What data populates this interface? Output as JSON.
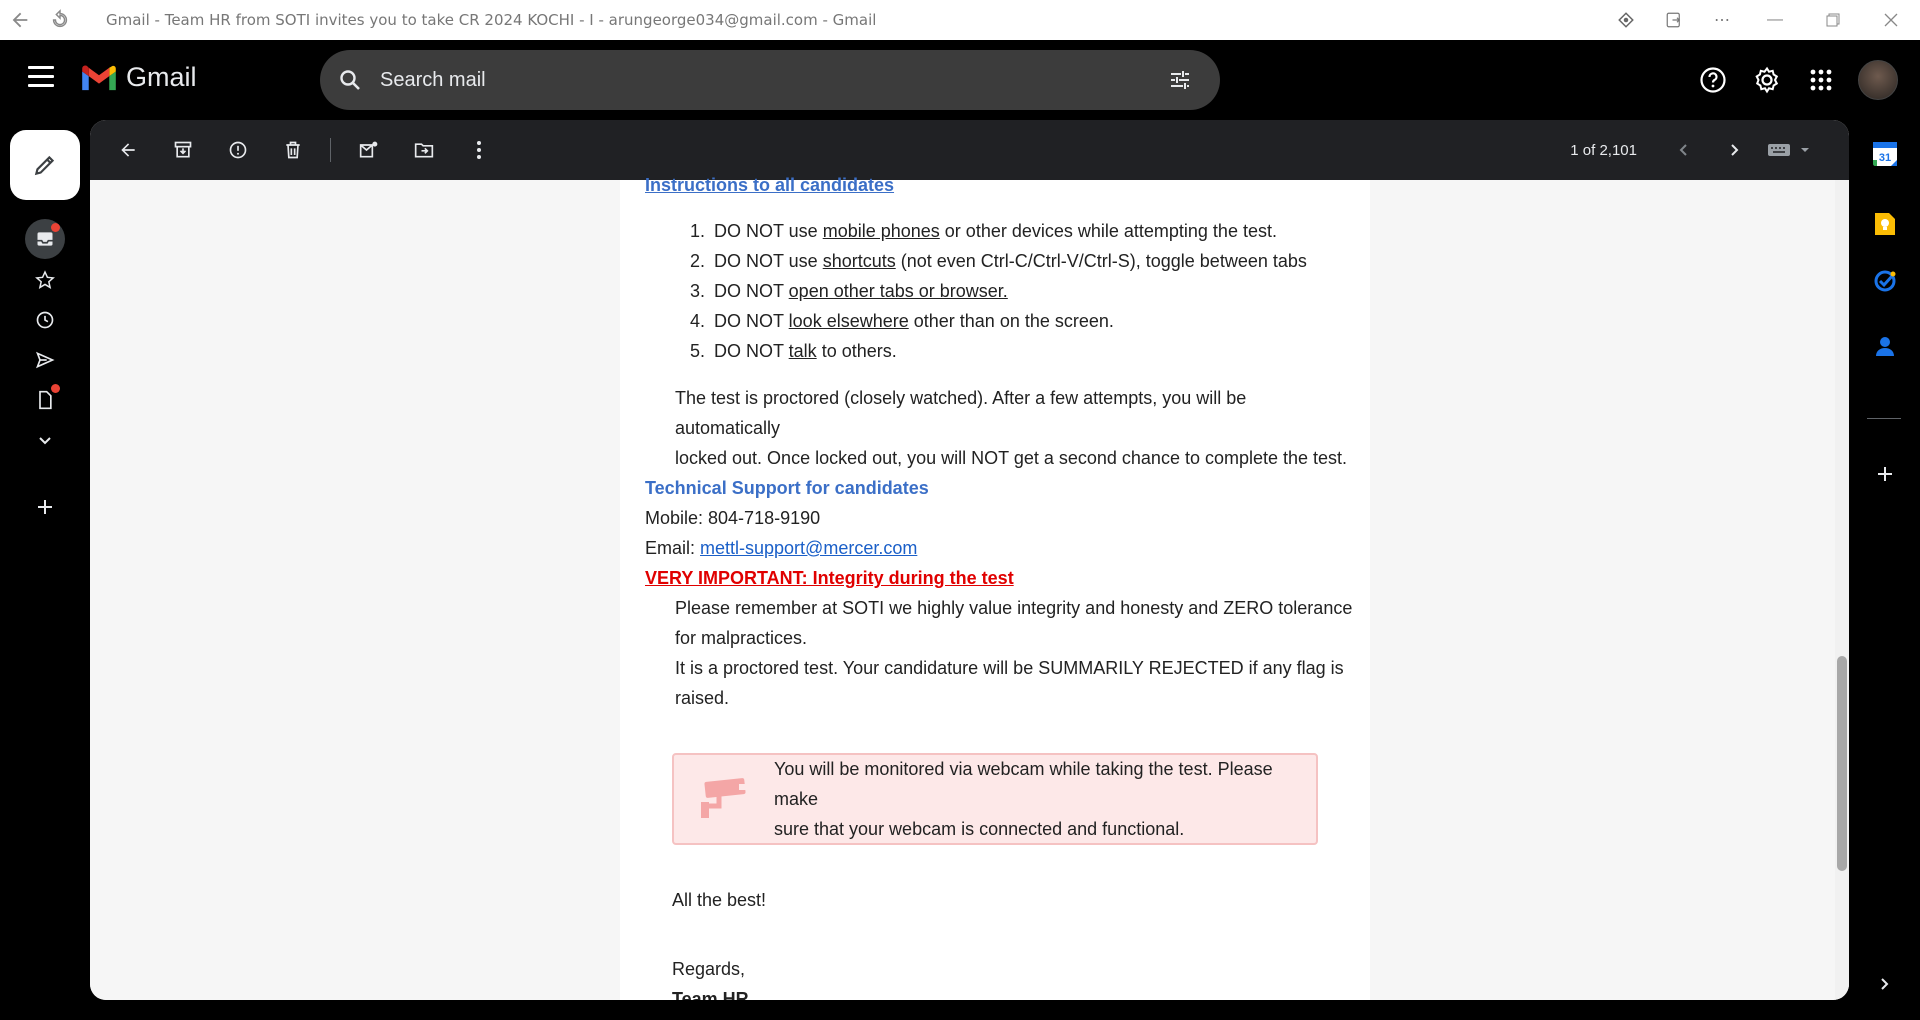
{
  "window": {
    "title": "Gmail - Team HR from SOTI invites you to take CR 2024 KOCHI - I - arungeorge034@gmail.com - Gmail"
  },
  "header": {
    "app_name": "Gmail",
    "search_placeholder": "Search mail"
  },
  "toolbar": {
    "pagination": "1 of 2,101"
  },
  "email": {
    "section_instructions": "Instructions to all candidates",
    "rules": [
      {
        "pre": "DO NOT use ",
        "link": "mobile phones",
        "post": " or other devices while attempting the test."
      },
      {
        "pre": "DO NOT use ",
        "link": "shortcuts",
        "post": " (not even Ctrl-C/Ctrl-V/Ctrl-S), toggle between tabs"
      },
      {
        "pre": "DO NOT ",
        "link": "open other tabs or browser.",
        "post": ""
      },
      {
        "pre": "DO NOT ",
        "link": "look elsewhere",
        "post": " other than on the screen."
      },
      {
        "pre": "DO NOT ",
        "link": "talk",
        "post": " to others."
      }
    ],
    "proctor_line1": "The test is proctored (closely watched). After a few attempts, you will be automatically",
    "proctor_line2": "locked out. Once locked out, you will NOT get a second chance to complete the test.",
    "support_heading": "Technical Support for candidates",
    "mobile": "Mobile: 804-718-9190",
    "email_label": "Email: ",
    "email_link": "mettl-support@mercer.com",
    "integrity_heading": "VERY IMPORTANT: Integrity during the test",
    "integrity_line1": "Please remember at SOTI we highly value integrity and honesty and ZERO tolerance",
    "integrity_line2": "for malpractices.",
    "integrity_line3": "It is a proctored test. Your candidature will be SUMMARILY REJECTED if any flag is",
    "integrity_line4": "raised.",
    "webcam_line1": "You will be monitored via webcam while taking the test. Please make",
    "webcam_line2": "sure that your webcam is connected and functional.",
    "closing": "All the best!",
    "regards": "Regards,",
    "signature": "Team HR"
  },
  "side_panel": {
    "calendar_day": "31"
  },
  "colors": {
    "accent_blue": "#3b6fc7",
    "warning_red": "#e00000",
    "alert_bg": "#fde8e8"
  }
}
